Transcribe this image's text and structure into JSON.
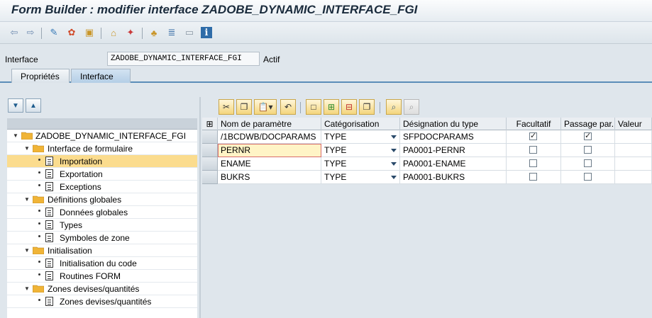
{
  "window": {
    "title": "Form Builder : modifier interface ZADOBE_DYNAMIC_INTERFACE_FGI"
  },
  "toolbar": {
    "icons": [
      "back-icon",
      "forward-icon",
      "switch-display-change-icon",
      "activate-icon",
      "object-list-icon",
      "other-object-icon",
      "where-used-icon",
      "hierarchy-icon",
      "layout-icon",
      "info-icon"
    ]
  },
  "header": {
    "label": "Interface",
    "value": "ZADOBE_DYNAMIC_INTERFACE_FGI",
    "status": "Actif"
  },
  "tabs": [
    {
      "label": "Propriétés"
    },
    {
      "label": "Interface"
    }
  ],
  "tree": {
    "expand_all_icon": "expand-all-icon",
    "collapse_all_icon": "collapse-all-icon",
    "items": [
      {
        "label": "ZADOBE_DYNAMIC_INTERFACE_FGI",
        "type": "folder"
      },
      {
        "label": "Interface de formulaire",
        "type": "folder"
      },
      {
        "label": "Importation",
        "type": "doc"
      },
      {
        "label": "Exportation",
        "type": "doc"
      },
      {
        "label": "Exceptions",
        "type": "doc"
      },
      {
        "label": "Définitions globales",
        "type": "folder"
      },
      {
        "label": "Données globales",
        "type": "doc"
      },
      {
        "label": "Types",
        "type": "doc"
      },
      {
        "label": "Symboles de zone",
        "type": "doc"
      },
      {
        "label": "Initialisation",
        "type": "folder"
      },
      {
        "label": "Initialisation du code",
        "type": "doc"
      },
      {
        "label": "Routines FORM",
        "type": "doc"
      },
      {
        "label": "Zones devises/quantités",
        "type": "folder"
      },
      {
        "label": "Zones devises/quantités",
        "type": "doc"
      }
    ]
  },
  "table": {
    "columns": [
      "Nom de paramètre",
      "Catégorisation",
      "Désignation du type",
      "Facultatif",
      "Passage par...",
      "Valeur"
    ],
    "rows": [
      {
        "name": "/1BCDWB/DOCPARAMS",
        "category": "TYPE",
        "type": "SFPDOCPARAMS",
        "optional": true,
        "by_value": true,
        "default": ""
      },
      {
        "name": "PERNR",
        "category": "TYPE",
        "type": "PA0001-PERNR",
        "optional": false,
        "by_value": false,
        "default": ""
      },
      {
        "name": "ENAME",
        "category": "TYPE",
        "type": "PA0001-ENAME",
        "optional": false,
        "by_value": false,
        "default": ""
      },
      {
        "name": "BUKRS",
        "category": "TYPE",
        "type": "PA0001-BUKRS",
        "optional": false,
        "by_value": false,
        "default": ""
      }
    ]
  },
  "colors": {
    "selected_row": "#fbdc8e",
    "folder": "#f0b437",
    "tab_active": "#b4cee6"
  }
}
